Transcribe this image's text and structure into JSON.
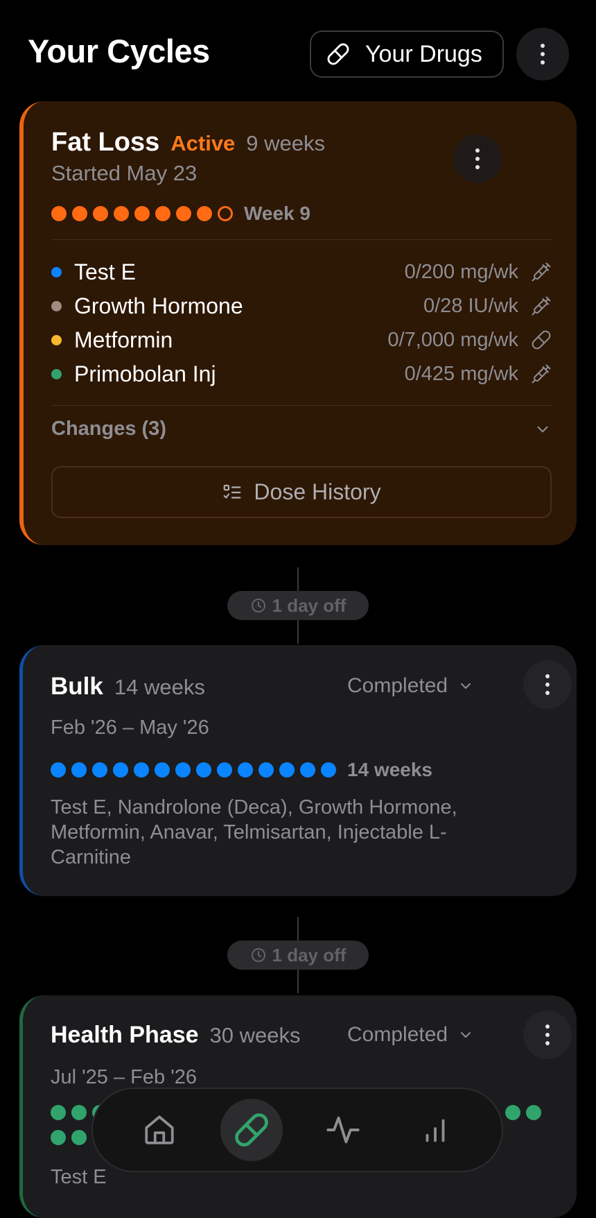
{
  "header": {
    "title": "Your Cycles",
    "drugs_button_label": "Your Drugs"
  },
  "cycles": [
    {
      "name": "Fat Loss",
      "status": "Active",
      "duration": "9 weeks",
      "started": "Started May 23",
      "week_label": "Week 9",
      "weeks_completed": 8,
      "weeks_total": 9,
      "accent_color": "#ff6a13",
      "drugs": [
        {
          "name": "Test E",
          "dose": "0/200 mg/wk",
          "color": "#0a84ff",
          "icon": "syringe-icon"
        },
        {
          "name": "Growth Hormone",
          "dose": "0/28 IU/wk",
          "color": "#a38a80",
          "icon": "syringe-icon"
        },
        {
          "name": "Metformin",
          "dose": "0/7,000 mg/wk",
          "color": "#f5b82e",
          "icon": "pill-icon"
        },
        {
          "name": "Primobolan Inj",
          "dose": "0/425 mg/wk",
          "color": "#30a46c",
          "icon": "syringe-icon"
        }
      ],
      "changes_label": "Changes (3)",
      "dose_history_label": "Dose History"
    },
    {
      "name": "Bulk",
      "duration": "14 weeks",
      "status": "Completed",
      "date_range": "Feb '26 – May '26",
      "week_label": "14 weeks",
      "weeks_completed": 14,
      "accent_color": "#0a84ff",
      "drug_list": "Test E, Nandrolone (Deca), Growth Hormone, Metformin, Anavar, Telmisartan, Injectable L-Carnitine"
    },
    {
      "name": "Health Phase",
      "duration": "30 weeks",
      "status": "Completed",
      "date_range": "Jul '25 – Feb '26",
      "accent_color": "#30a46c",
      "drug_list": "Test E"
    }
  ],
  "gaps": [
    {
      "label": "1 day off"
    },
    {
      "label": "1 day off"
    }
  ],
  "tabbar": {
    "tabs": [
      {
        "icon": "home-icon",
        "selected": false
      },
      {
        "icon": "pill-icon",
        "selected": true
      },
      {
        "icon": "activity-icon",
        "selected": false
      },
      {
        "icon": "chart-icon",
        "selected": false
      }
    ]
  }
}
